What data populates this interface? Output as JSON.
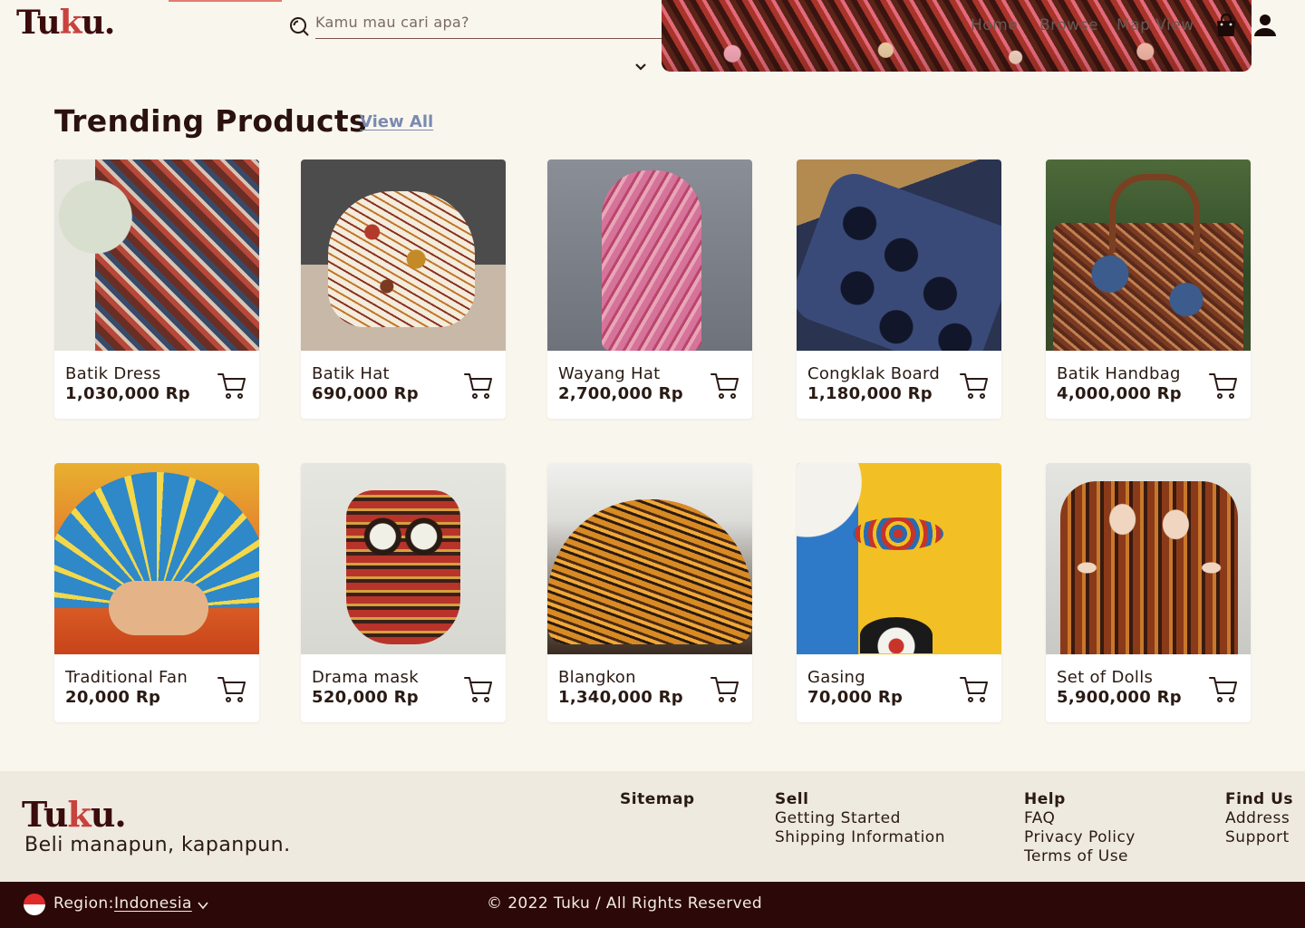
{
  "brand": {
    "logo_prefix": "Tu",
    "logo_k": "k",
    "logo_suffix": "u.",
    "tagline": "Beli manapun, kapanpun."
  },
  "header": {
    "search_placeholder": "Kamu mau cari apa?",
    "nav": {
      "home": "Home",
      "browse": "Browse",
      "map": "Map View"
    },
    "icons": [
      "search-icon",
      "chevron-down-icon",
      "shopping-bag-icon",
      "user-icon"
    ]
  },
  "section": {
    "title": "Trending Products",
    "view_all": "View All"
  },
  "products": [
    {
      "name": "Batik Dress",
      "price": "1,030,000 Rp"
    },
    {
      "name": "Batik Hat",
      "price": "690,000 Rp"
    },
    {
      "name": "Wayang Hat",
      "price": "2,700,000 Rp"
    },
    {
      "name": "Congklak Board",
      "price": "1,180,000 Rp"
    },
    {
      "name": "Batik Handbag",
      "price": "4,000,000 Rp"
    },
    {
      "name": "Traditional Fan",
      "price": "20,000 Rp"
    },
    {
      "name": "Drama mask",
      "price": "520,000 Rp"
    },
    {
      "name": "Blangkon",
      "price": "1,340,000 Rp"
    },
    {
      "name": "Gasing",
      "price": "70,000 Rp"
    },
    {
      "name": "Set of Dolls",
      "price": "5,900,000 Rp"
    }
  ],
  "footer": {
    "sitemap": {
      "heading": "Sitemap"
    },
    "sell": {
      "heading": "Sell",
      "links": [
        "Getting Started",
        "Shipping Information"
      ]
    },
    "help": {
      "heading": "Help",
      "links": [
        "FAQ",
        "Privacy Policy",
        "Terms of Use"
      ]
    },
    "find_us": {
      "heading": "Find Us",
      "links": [
        "Address",
        "Support"
      ]
    }
  },
  "bottom_bar": {
    "region_label": "Region:",
    "region_value": "Indonesia",
    "copyright": "© 2022 Tuku / All Rights Reserved"
  },
  "colors": {
    "brand": "#3a0c0c",
    "brand_accent": "#c8423e",
    "background": "#f9f6ee",
    "footer_bg": "#eeeadf",
    "bottom_bar_bg": "#2c0808",
    "link": "#7a8ab0"
  }
}
